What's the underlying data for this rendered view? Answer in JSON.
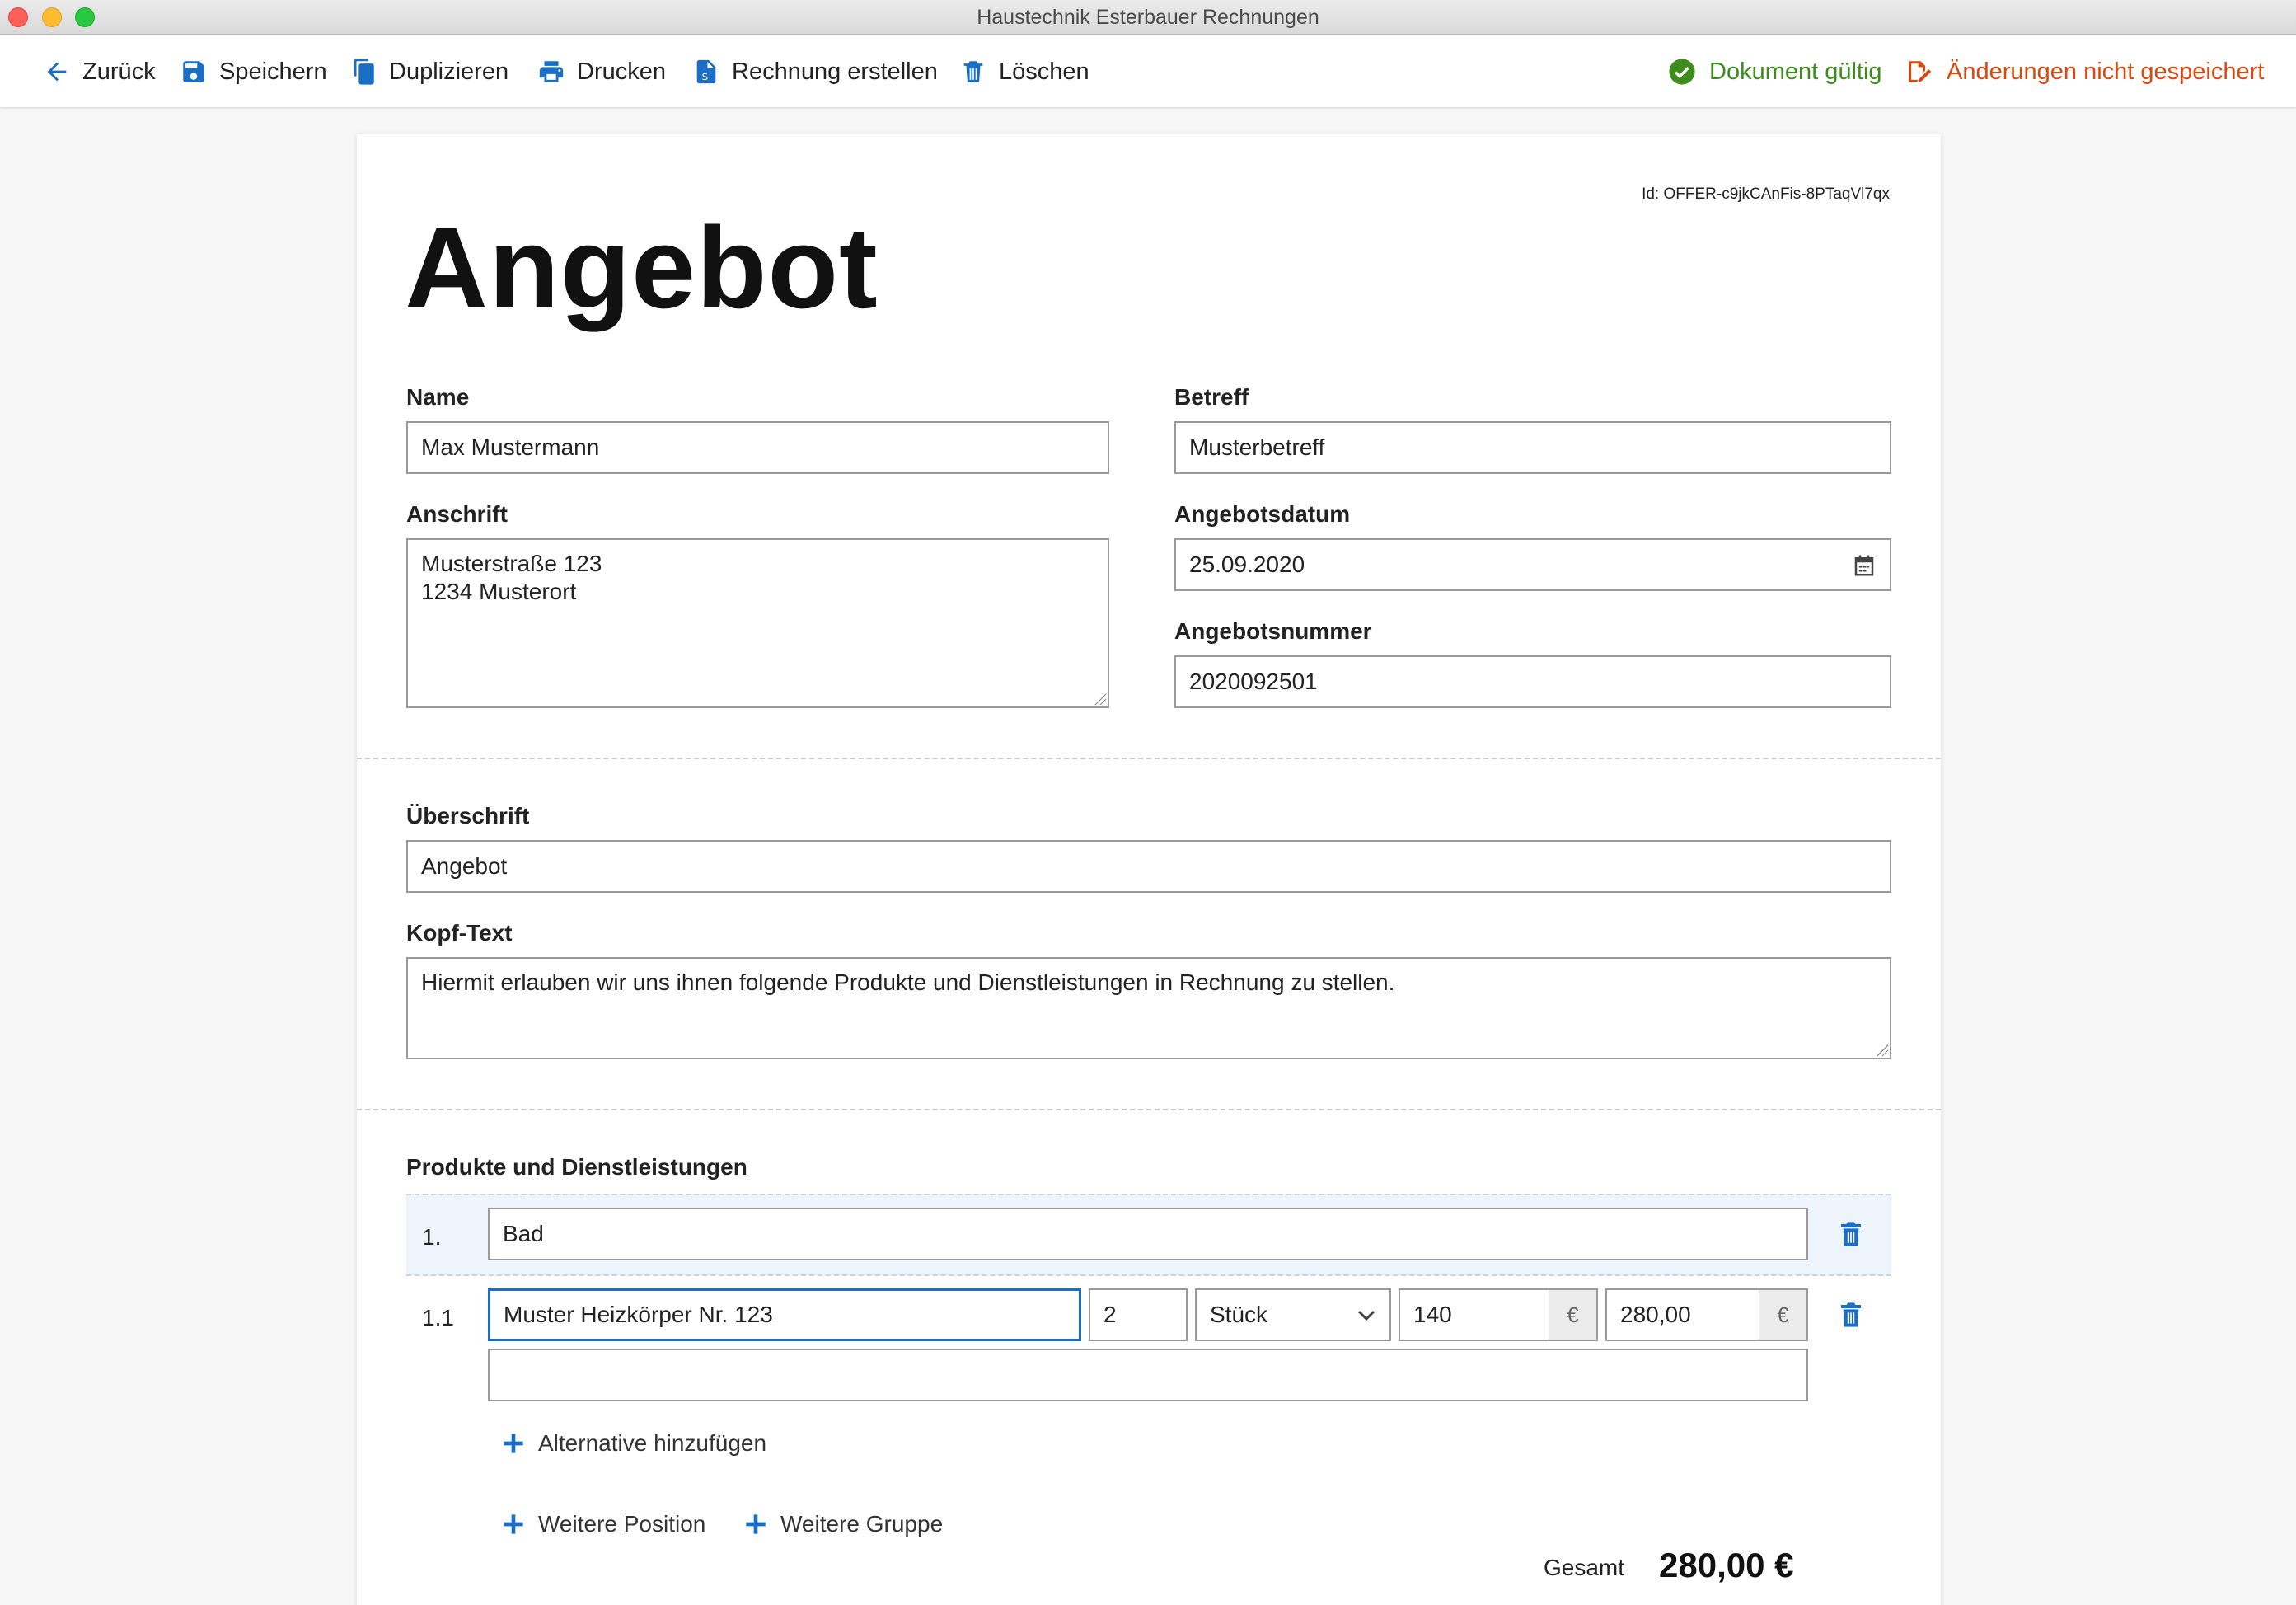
{
  "window": {
    "title": "Haustechnik Esterbauer Rechnungen"
  },
  "toolbar": {
    "back": "Zurück",
    "save": "Speichern",
    "duplicate": "Duplizieren",
    "print": "Drucken",
    "create_invoice": "Rechnung erstellen",
    "delete": "Löschen",
    "status_valid": "Dokument gültig",
    "status_unsaved": "Änderungen nicht gespeichert"
  },
  "colors": {
    "accent": "#1a6fc4",
    "valid": "#3d8c1c",
    "unsaved": "#d9480f"
  },
  "document": {
    "id": "Id: OFFER-c9jkCAnFis-8PTaqVl7qx",
    "title": "Angebot",
    "name_label": "Name",
    "name_value": "Max Mustermann",
    "subject_label": "Betreff",
    "subject_value": "Musterbetreff",
    "address_label": "Anschrift",
    "address_value": "Musterstraße 123\n1234 Musterort",
    "date_label": "Angebotsdatum",
    "date_value": "25.09.2020",
    "number_label": "Angebotsnummer",
    "number_value": "2020092501",
    "heading_label": "Überschrift",
    "heading_value": "Angebot",
    "header_text_label": "Kopf-Text",
    "header_text_value": "Hiermit erlauben wir uns ihnen folgende Produkte und Dienstleistungen in Rechnung zu stellen."
  },
  "positions": {
    "section_label": "Produkte und Dienstleistungen",
    "group": {
      "number": "1.",
      "name": "Bad"
    },
    "item": {
      "number": "1.1",
      "name": "Muster Heizkörper Nr. 123",
      "quantity": "2",
      "unit": "Stück",
      "unit_price": "140",
      "total": "280,00",
      "currency": "€",
      "description": ""
    },
    "add_alternative": "Alternative hinzufügen",
    "add_position": "Weitere Position",
    "add_group": "Weitere Gruppe"
  },
  "total": {
    "label": "Gesamt",
    "value": "280,00 €"
  }
}
